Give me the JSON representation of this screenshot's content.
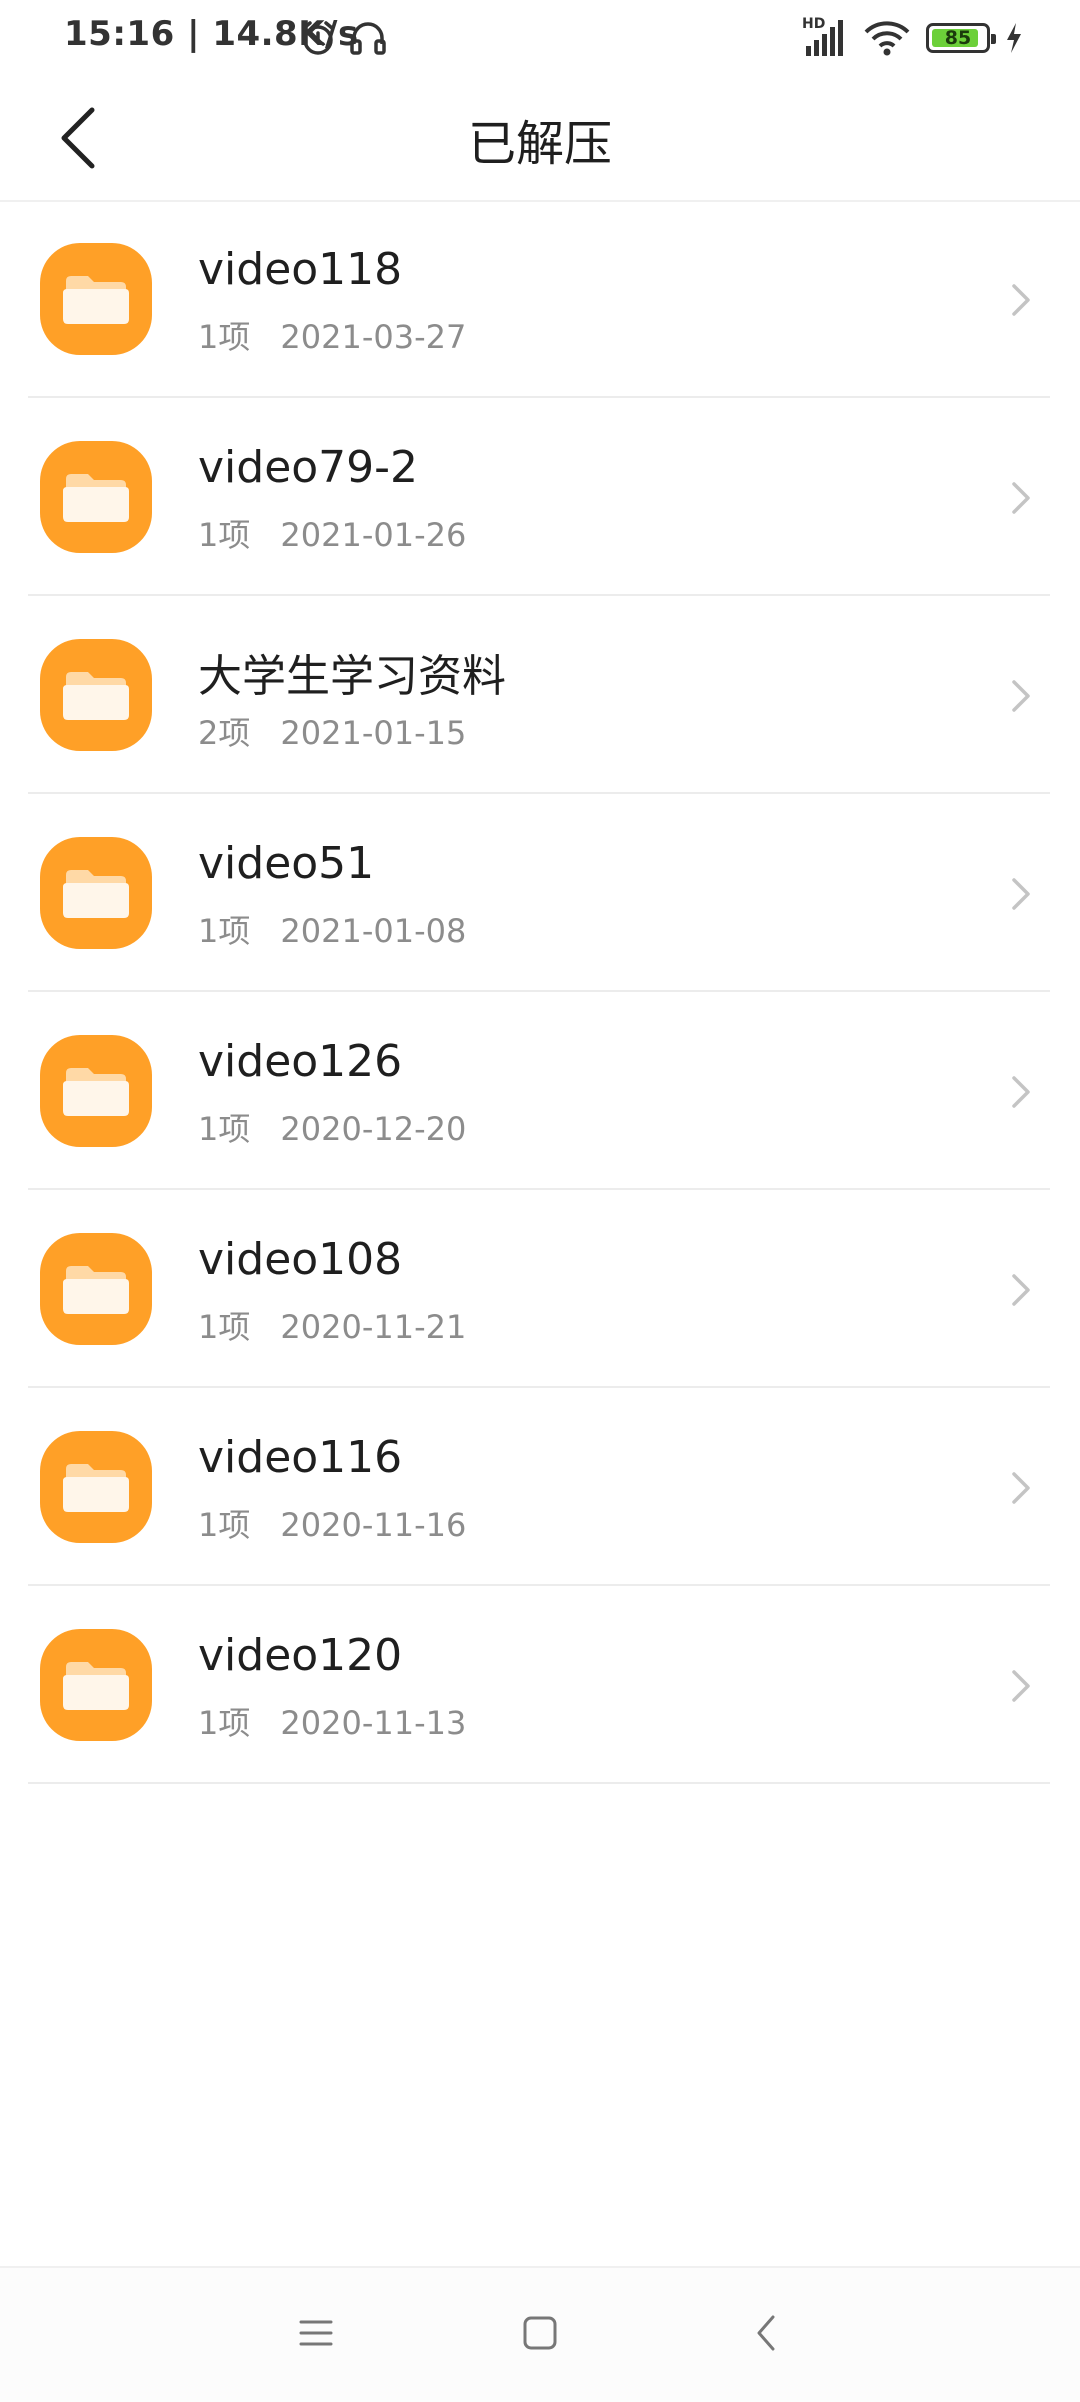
{
  "status_bar": {
    "time_speed": "15:16 | 14.8K/s",
    "signal_label": "HD",
    "battery_level": "85",
    "icons": [
      "alarm-icon",
      "headset-icon",
      "signal-icon",
      "wifi-icon",
      "battery-icon",
      "charging-icon"
    ]
  },
  "header": {
    "title": "已解压",
    "back_icon": "back-arrow-icon"
  },
  "colors": {
    "folder_accent": "#FFA027",
    "text_primary": "#1F1F1F",
    "text_secondary": "#8C8C8C"
  },
  "items": [
    {
      "name": "video118",
      "count": "1项",
      "date": "2021-03-27"
    },
    {
      "name": "video79-2",
      "count": "1项",
      "date": "2021-01-26"
    },
    {
      "name": "大学生学习资料",
      "count": "2项",
      "date": "2021-01-15"
    },
    {
      "name": "video51",
      "count": "1项",
      "date": "2021-01-08"
    },
    {
      "name": "video126",
      "count": "1项",
      "date": "2020-12-20"
    },
    {
      "name": "video108",
      "count": "1项",
      "date": "2020-11-21"
    },
    {
      "name": "video116",
      "count": "1项",
      "date": "2020-11-16"
    },
    {
      "name": "video120",
      "count": "1项",
      "date": "2020-11-13"
    }
  ],
  "nav_bar": {
    "icons": [
      "menu-icon",
      "home-square-icon",
      "back-icon"
    ]
  }
}
